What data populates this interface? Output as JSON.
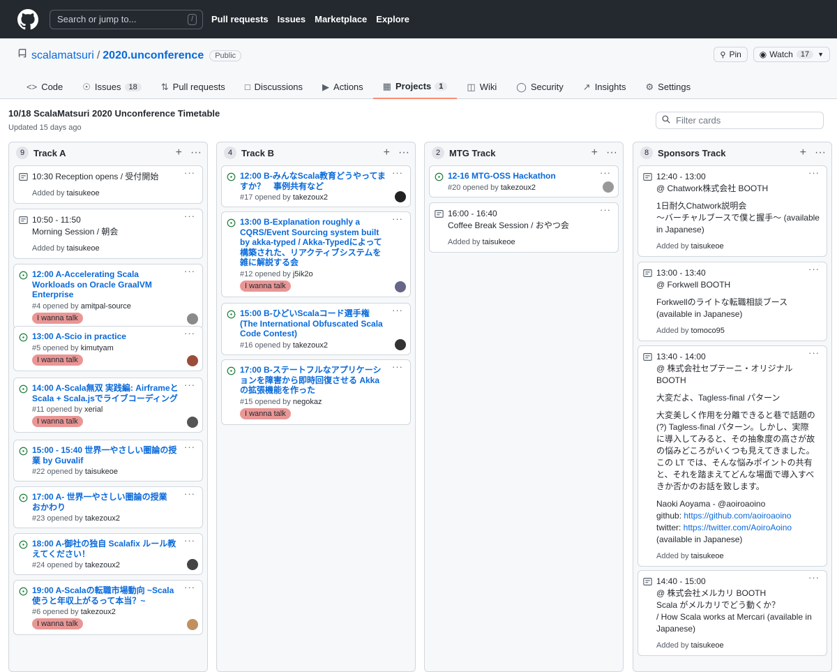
{
  "nav": {
    "search_placeholder": "Search or jump to...",
    "slash": "/",
    "items": [
      "Pull requests",
      "Issues",
      "Marketplace",
      "Explore"
    ]
  },
  "repo": {
    "owner": "scalamatsuri",
    "name": "2020.unconference",
    "visibility": "Public",
    "pin": "Pin",
    "watch": "Watch",
    "watch_count": "17"
  },
  "tabs": [
    {
      "label": "Code"
    },
    {
      "label": "Issues",
      "count": "18"
    },
    {
      "label": "Pull requests"
    },
    {
      "label": "Discussions"
    },
    {
      "label": "Actions"
    },
    {
      "label": "Projects",
      "count": "1"
    },
    {
      "label": "Wiki"
    },
    {
      "label": "Security"
    },
    {
      "label": "Insights"
    },
    {
      "label": "Settings"
    }
  ],
  "project": {
    "title": "10/18 ScalaMatsuri 2020 Unconference Timetable",
    "updated": "Updated 15 days ago",
    "filter_placeholder": "Filter cards"
  },
  "colors": {
    "topbar": "#24292f",
    "link": "#0969da",
    "label": "#e99695",
    "open": "#1a7f37"
  },
  "columns": [
    {
      "name": "Track A",
      "count": "9",
      "cards": [
        {
          "type": "note",
          "lines": [
            "10:30 Reception opens / 受付開始"
          ],
          "added": "Added by ",
          "by": "taisukeoe"
        },
        {
          "type": "note",
          "lines": [
            "10:50 - 11:50",
            "Morning Session / 朝会"
          ],
          "added": "Added by ",
          "by": "taisukeoe"
        },
        {
          "type": "issue",
          "title": "12:00 A-Accelerating Scala Workloads on Oracle GraalVM Enterprise",
          "meta": "#4 opened by ",
          "by": "amitpal-source",
          "label": "I wanna talk"
        },
        {
          "type": "issue",
          "title": "13:00 A-Scio in practice",
          "meta": "#5 opened by ",
          "by": "kimutyam",
          "label": "I wanna talk"
        },
        {
          "type": "issue",
          "title": "14:00 A-Scala無双 実践編: AirframeとScala + Scala.jsでライブコーディング",
          "meta": "#11 opened by ",
          "by": "xerial",
          "label": "I wanna talk"
        },
        {
          "type": "issue",
          "title": "15:00 - 15:40 世界一やさしい圏論の授業 by Guvalif",
          "meta": "#22 opened by ",
          "by": "taisukeoe"
        },
        {
          "type": "issue",
          "title": "17:00 A- 世界一やさしい圏論の授業　おかわり",
          "meta": "#23 opened by ",
          "by": "takezoux2"
        },
        {
          "type": "issue",
          "title": "18:00 A-御社の独自 Scalafix ルール教えてください！",
          "meta": "#24 opened by ",
          "by": "takezoux2"
        },
        {
          "type": "issue",
          "title": "19:00 A-Scalaの転職市場動向 ~Scala使うと年収上がるって本当？~",
          "meta": "#6 opened by ",
          "by": "takezoux2",
          "label": "I wanna talk"
        }
      ]
    },
    {
      "name": "Track B",
      "count": "4",
      "cards": [
        {
          "type": "issue",
          "title": "12:00 B-みんなScala教育どうやってますか？　事例共有など",
          "meta": "#17 opened by ",
          "by": "takezoux2"
        },
        {
          "type": "issue",
          "title": "13:00 B-Explanation roughly a CQRS/Event Sourcing system built by akka-typed / Akka-Typedによって構築された、リアクティブシステムを雑に解説する会",
          "meta": "#12 opened by ",
          "by": "j5ik2o",
          "label": "I wanna talk"
        },
        {
          "type": "issue",
          "title": "15:00 B-ひどいScalaコード選手権 (The International Obfuscated Scala Code Contest)",
          "meta": "#16 opened by ",
          "by": "takezoux2"
        },
        {
          "type": "issue",
          "title": "17:00 B-ステートフルなアプリケーションを障害から即時回復させる Akka の拡張機能を作った",
          "meta": "#15 opened by ",
          "by": "negokaz",
          "label": "I wanna talk"
        }
      ]
    },
    {
      "name": "MTG Track",
      "count": "2",
      "cards": [
        {
          "type": "issue",
          "title": "12-16 MTG-OSS Hackathon",
          "meta": "#20 opened by ",
          "by": "takezoux2"
        },
        {
          "type": "note",
          "lines": [
            "16:00 - 16:40",
            "Coffee Break Session / おやつ会"
          ],
          "added": "Added by ",
          "by": "taisukeoe"
        }
      ]
    },
    {
      "name": "Sponsors Track",
      "count": "8",
      "cards": [
        {
          "type": "note",
          "lines": [
            "12:40 - 13:00",
            "@ Chatwork株式会社 BOOTH",
            "",
            "1日耐久Chatwork説明会",
            "〜バーチャルブースで僕と握手〜 (available",
            "in Japanese)"
          ],
          "added": "Added by ",
          "by": "taisukeoe"
        },
        {
          "type": "note",
          "lines": [
            "13:00 - 13:40",
            "@ Forkwell BOOTH",
            "",
            "Forkwellのライトな転職相談ブース",
            "(available in Japanese)"
          ],
          "added": "Added by ",
          "by": "tomoco95"
        },
        {
          "type": "note",
          "lines": [
            "13:40 - 14:00",
            "@ 株式会社セプテーニ・オリジナル",
            "BOOTH",
            "",
            "大変だよ、Tagless-final パターン",
            "",
            "大変美しく作用を分離できると巷で話題の",
            "(?) Tagless-final パターン。しかし、実際",
            "に導入してみると、その抽象度の高さが故",
            "の悩みどころがいくつも見えてきました。",
            "この LT では、そんな悩みポイントの共有",
            "と、それを踏まえてどんな場面で導入すべ",
            "きか否かのお話を致します。",
            "",
            "Naoki Aoyama - @aoiroaoino",
            "github: https://github.com/aoiroaoino",
            "twitter: https://twitter.com/AoiroAoino",
            "(available in Japanese)"
          ],
          "added": "Added by ",
          "by": "taisukeoe"
        },
        {
          "type": "note",
          "lines": [
            "14:40 - 15:00",
            "@ 株式会社メルカリ BOOTH",
            "Scala がメルカリでどう動くか？",
            "/ How Scala works at Mercari (available in",
            "Japanese)"
          ],
          "added": "Added by ",
          "by": "taisukeoe"
        }
      ]
    }
  ]
}
